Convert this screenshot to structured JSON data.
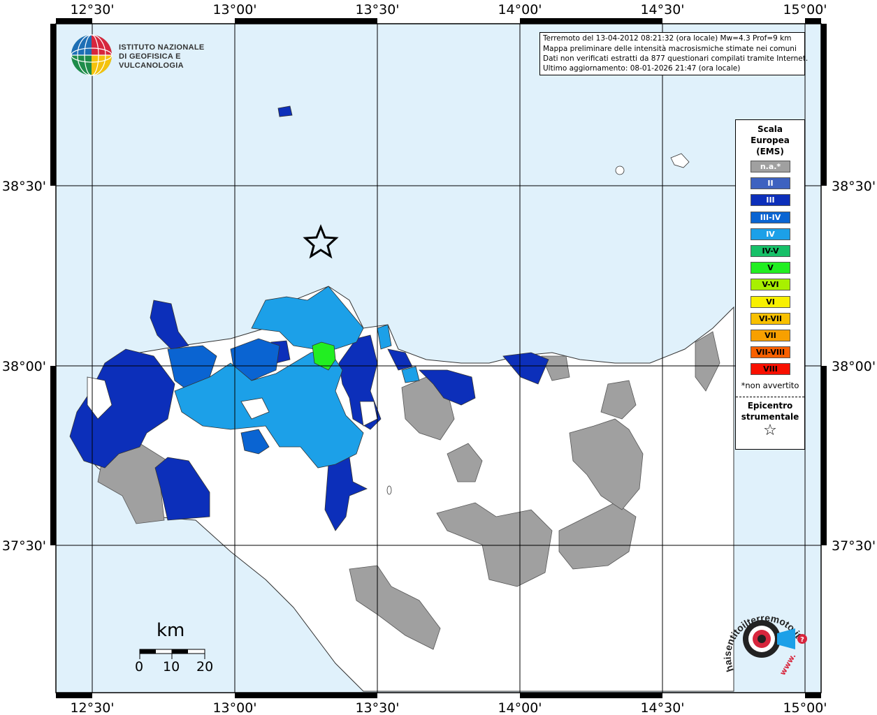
{
  "info": {
    "line1": "Terremoto del 13-04-2012 08:21:32 (ora locale) Mw=4.3 Prof=9 km",
    "line2": "Mappa preliminare delle intensità macrosismiche stimate nei comuni",
    "line3": "Dati non verificati estratti da 877 questionari compilati tramite Internet.",
    "line4": "Ultimo aggiornamento: 08-01-2026 21:47 (ora locale)"
  },
  "institute": {
    "line1": "ISTITUTO NAZIONALE",
    "line2": "DI GEOFISICA E VULCANOLOGIA"
  },
  "axes": {
    "x_top": [
      "12°30'",
      "13°00'",
      "13°30'",
      "14°00'",
      "14°30'",
      "15°00'"
    ],
    "x_bottom": [
      "12°30'",
      "13°00'",
      "13°30'",
      "14°00'",
      "14°30'",
      "15°00'"
    ],
    "y_left": [
      "38°30'",
      "38°00'",
      "37°30'"
    ],
    "y_right": [
      "38°30'",
      "38°00'",
      "37°30'"
    ]
  },
  "legend": {
    "title_line1": "Scala",
    "title_line2": "Europea",
    "title_line3": "(EMS)",
    "items": [
      {
        "label": "n.a.*",
        "color": "#a0a0a0",
        "text_color": "#ffffff"
      },
      {
        "label": "II",
        "color": "#3e62c0",
        "text_color": "#ffffff"
      },
      {
        "label": "III",
        "color": "#0c2fba",
        "text_color": "#ffffff"
      },
      {
        "label": "III-IV",
        "color": "#0a64d2",
        "text_color": "#ffffff"
      },
      {
        "label": "IV",
        "color": "#1ca0e8",
        "text_color": "#ffffff"
      },
      {
        "label": "IV-V",
        "color": "#17c068",
        "text_color": "#000000"
      },
      {
        "label": "V",
        "color": "#22ee22",
        "text_color": "#000000"
      },
      {
        "label": "V-VI",
        "color": "#a8f000",
        "text_color": "#000000"
      },
      {
        "label": "VI",
        "color": "#f8f000",
        "text_color": "#000000"
      },
      {
        "label": "VI-VII",
        "color": "#f8c000",
        "text_color": "#000000"
      },
      {
        "label": "VII",
        "color": "#f8a000",
        "text_color": "#000000"
      },
      {
        "label": "VII-VIII",
        "color": "#f86000",
        "text_color": "#000000"
      },
      {
        "label": "VIII",
        "color": "#f81000",
        "text_color": "#000000"
      }
    ],
    "note": "*non avvertito",
    "epicenter_line1": "Epicentro",
    "epicenter_line2": "strumentale",
    "epicenter_symbol": "☆"
  },
  "scale_bar": {
    "unit": "km",
    "labels": [
      "0",
      "10",
      "20"
    ]
  },
  "colors": {
    "sea": "#e0f1fb",
    "land_white": "#ffffff",
    "na_gray": "#a0a0a0",
    "int_iii": "#0c2fba",
    "int_iii_iv": "#0a64d2",
    "int_iv": "#1ca0e8",
    "int_v": "#22ee22"
  },
  "hsi_logo": {
    "text": "haisentitoilterremoto.it",
    "www": "www.",
    "question": "?"
  }
}
